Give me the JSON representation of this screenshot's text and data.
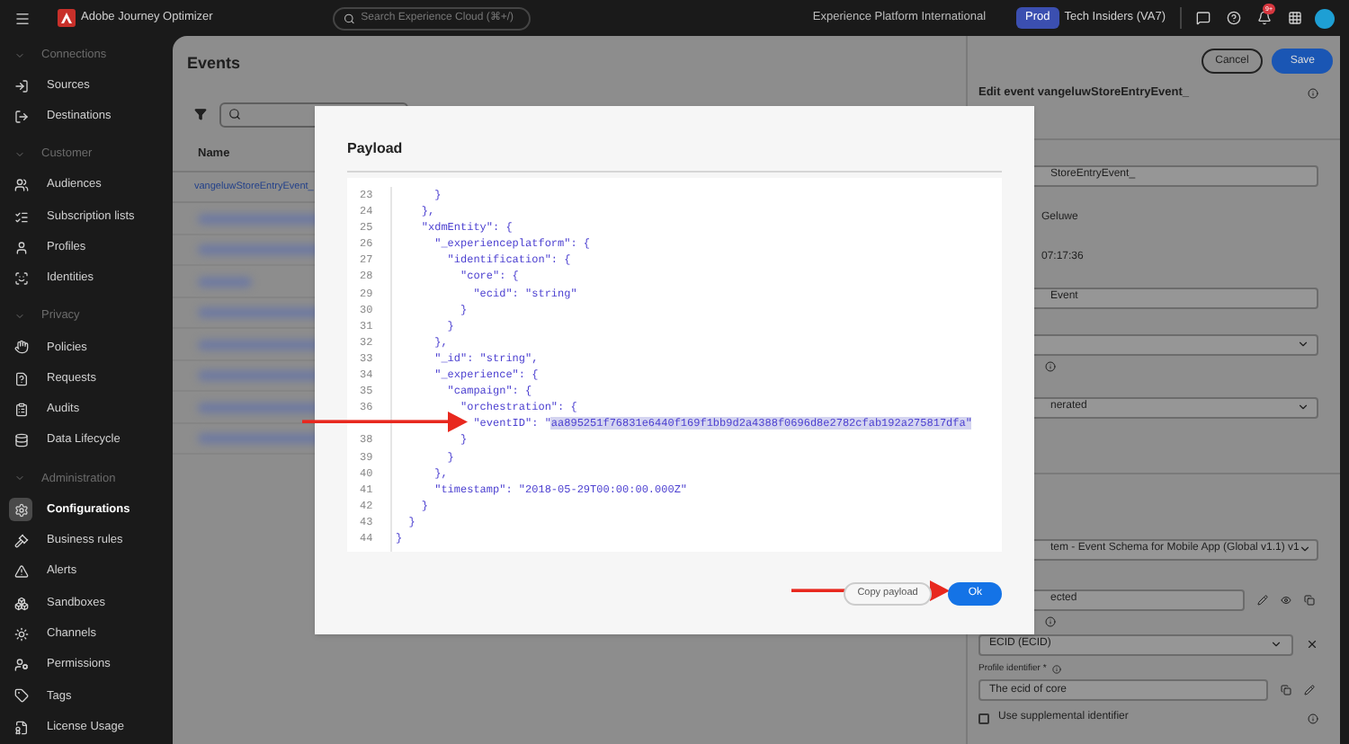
{
  "top_bar": {
    "app_name": "Adobe Journey Optimizer",
    "search": {
      "placeholder": "Search Experience Cloud (⌘+/)"
    },
    "org": "Experience Platform International",
    "sandbox_badge": "Prod",
    "sandbox_name": "Tech Insiders (VA7)",
    "notifications": "9+"
  },
  "sidebar": {
    "sections": [
      {
        "title": "Connections",
        "items": [
          {
            "label": "Sources",
            "selected": false
          },
          {
            "label": "Destinations",
            "selected": false
          }
        ]
      },
      {
        "title": "Customer",
        "items": [
          {
            "label": "Audiences",
            "selected": false
          },
          {
            "label": "Subscription lists",
            "selected": false
          },
          {
            "label": "Profiles",
            "selected": false
          },
          {
            "label": "Identities",
            "selected": false
          }
        ]
      },
      {
        "title": "Privacy",
        "items": [
          {
            "label": "Policies",
            "selected": false
          },
          {
            "label": "Requests",
            "selected": false
          },
          {
            "label": "Audits",
            "selected": false
          },
          {
            "label": "Data Lifecycle",
            "selected": false
          }
        ]
      },
      {
        "title": "Administration",
        "items": [
          {
            "label": "Configurations",
            "selected": true
          },
          {
            "label": "Business rules",
            "selected": false
          },
          {
            "label": "Alerts",
            "selected": false
          },
          {
            "label": "Sandboxes",
            "selected": false
          },
          {
            "label": "Channels",
            "selected": false
          },
          {
            "label": "Permissions",
            "selected": false
          },
          {
            "label": "Tags",
            "selected": false
          },
          {
            "label": "License Usage",
            "selected": false
          }
        ]
      }
    ]
  },
  "events": {
    "title": "Events",
    "table": {
      "columns": [
        "Name"
      ],
      "rows": [
        "vangeluwStoreEntryEvent_"
      ]
    }
  },
  "edit_panel": {
    "buttons": {
      "cancel": "Cancel",
      "save": "Save"
    },
    "title": "Edit event vangeluwStoreEntryEvent_",
    "fields": [
      {
        "kind": "input",
        "value": "StoreEntryEvent_"
      },
      {
        "kind": "text",
        "value": "Geluwe"
      },
      {
        "kind": "text",
        "value": "07:17:36"
      },
      {
        "kind": "input",
        "value": "Event"
      },
      {
        "kind": "select"
      },
      {
        "kind": "info"
      },
      {
        "kind": "select",
        "value": "nerated"
      },
      {
        "kind": "divider"
      },
      {
        "kind": "select",
        "value": "tem - Event Schema for Mobile App (Global v1.1) v1"
      },
      {
        "kind": "input-actions",
        "value": "ected"
      },
      {
        "kind": "info"
      },
      {
        "kind": "select-remove",
        "value": "ECID (ECID)"
      },
      {
        "kind": "label",
        "value": "Profile identifier *"
      },
      {
        "kind": "input-copy",
        "value": "The ecid of core"
      },
      {
        "kind": "checkbox",
        "value": "Use supplemental identifier",
        "checked": false
      }
    ]
  },
  "dialog": {
    "title": "Payload",
    "code": [
      {
        "number": "23",
        "text": "      }"
      },
      {
        "number": "24",
        "text": "    },"
      },
      {
        "number": "25",
        "text": "    \"xdmEntity\": {"
      },
      {
        "number": "26",
        "text": "      \"_experienceplatform\": {"
      },
      {
        "number": "27",
        "text": "        \"identification\": {"
      },
      {
        "number": "28",
        "text": "          \"core\": {"
      },
      {
        "number": "29",
        "text": "            \"ecid\": \"string\""
      },
      {
        "number": "30",
        "text": "          }"
      },
      {
        "number": "31",
        "text": "        }"
      },
      {
        "number": "32",
        "text": "      },"
      },
      {
        "number": "33",
        "text": "      \"_id\": \"string\","
      },
      {
        "number": "34",
        "text": "      \"_experience\": {"
      },
      {
        "number": "35",
        "text": "        \"campaign\": {"
      },
      {
        "number": "36",
        "text": "          \"orchestration\": {"
      },
      {
        "text": "            \"eventID\": \"",
        "selection": "aa895251f76831e6440f169f1bb9d2a4388f0696d8e2782cfab192a275817dfa\""
      },
      {
        "number": "38",
        "text": "          }"
      },
      {
        "number": "39",
        "text": "        }"
      },
      {
        "number": "40",
        "text": "      },"
      },
      {
        "number": "41",
        "text": "      \"timestamp\": \"2018-05-29T00:00:00.000Z\""
      },
      {
        "number": "42",
        "text": "    }"
      },
      {
        "number": "43",
        "text": "  }"
      },
      {
        "number": "44",
        "text": "}"
      }
    ],
    "buttons": {
      "copy": "Copy payload",
      "ok": "Ok"
    }
  }
}
